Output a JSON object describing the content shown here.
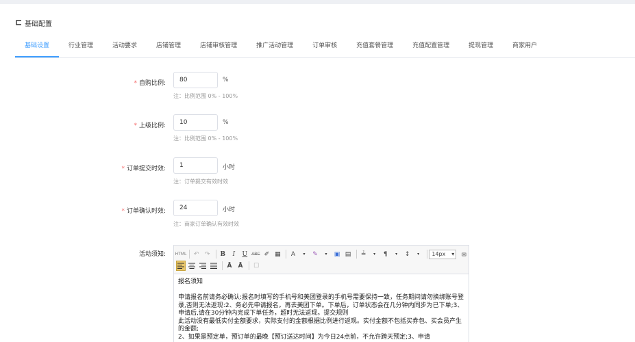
{
  "page": {
    "title": "基础配置"
  },
  "tabs": [
    {
      "label": "基础设置",
      "active": true
    },
    {
      "label": "行业管理"
    },
    {
      "label": "活动要求"
    },
    {
      "label": "店铺管理"
    },
    {
      "label": "店铺审核管理"
    },
    {
      "label": "推广活动管理"
    },
    {
      "label": "订单审核"
    },
    {
      "label": "充值套餐管理"
    },
    {
      "label": "充值配置管理"
    },
    {
      "label": "提现管理"
    },
    {
      "label": "商家用户"
    }
  ],
  "form": {
    "self_ratio": {
      "label": "自购比例:",
      "value": "80",
      "unit": "%",
      "hint": "注：比例范围 0% - 100%"
    },
    "upper_ratio": {
      "label": "上级比例:",
      "value": "10",
      "unit": "%",
      "hint": "注：比例范围 0% - 100%"
    },
    "submit_limit": {
      "label": "订单提交时效:",
      "value": "1",
      "unit": "小时",
      "hint": "注：订单提交有效时效"
    },
    "confirm_limit": {
      "label": "订单确认时效:",
      "value": "24",
      "unit": "小时",
      "hint": "注：商家订单确认有效时效"
    },
    "notice": {
      "label": "活动须知:"
    }
  },
  "editor": {
    "font_size": "14px",
    "toolbar_row1": [
      "HTML",
      "↶",
      "↷",
      "B",
      "I",
      "U",
      "ABC",
      "✐",
      "▦",
      "A",
      "✎",
      "▣",
      "▤",
      "≟",
      "¶",
      "↕"
    ],
    "content": [
      "报名须知",
      "",
      "申请报名前请务必确认:报名时填写的手机号和美团登录的手机号需要保持一致，任务期间请勿换绑账号登录,否则无法返现:2、务必先申请报名，再去美团下单。下单后，订单状态会在几分钟内同步为已下单;3、申请后,请在30分钟内完成下单任务，超时无法返现。提交规则",
      "此活动没有最低实付金额要求，实际支付的金额根据比例进行返现。实付金额不包括买券包、买会员产生的金额;",
      "2、如果是预定单，预订单的最晚【预订送达时间】为今日24点前，不允许跨天预定;3、申请"
    ]
  }
}
